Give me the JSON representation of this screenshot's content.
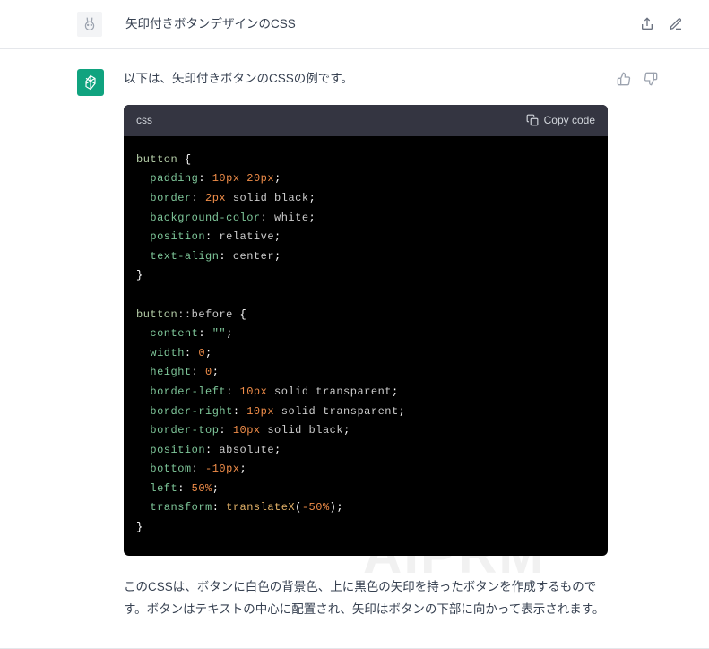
{
  "header": {
    "title": "矢印付きボタンデザインのCSS"
  },
  "watermark": "AIPRM",
  "response": {
    "intro": "以下は、矢印付きボタンのCSSの例です。",
    "body": "このCSSは、ボタンに白色の背景色、上に黒色の矢印を持ったボタンを作成するものです。ボタンはテキストの中心に配置され、矢印はボタンの下部に向かって表示されます。",
    "code": {
      "language": "css",
      "copy_label": "Copy code",
      "lines": [
        [
          {
            "t": "button ",
            "c": "tk-sel"
          },
          {
            "t": "{",
            "c": "tk-punc"
          }
        ],
        [
          {
            "t": "  ",
            "c": ""
          },
          {
            "t": "padding",
            "c": "tk-prop"
          },
          {
            "t": ": ",
            "c": "tk-punc"
          },
          {
            "t": "10px",
            "c": "tk-num"
          },
          {
            "t": " ",
            "c": ""
          },
          {
            "t": "20px",
            "c": "tk-num"
          },
          {
            "t": ";",
            "c": "tk-punc"
          }
        ],
        [
          {
            "t": "  ",
            "c": ""
          },
          {
            "t": "border",
            "c": "tk-prop"
          },
          {
            "t": ": ",
            "c": "tk-punc"
          },
          {
            "t": "2px",
            "c": "tk-num"
          },
          {
            "t": " solid black",
            "c": "tk-kw"
          },
          {
            "t": ";",
            "c": "tk-punc"
          }
        ],
        [
          {
            "t": "  ",
            "c": ""
          },
          {
            "t": "background-color",
            "c": "tk-prop"
          },
          {
            "t": ": ",
            "c": "tk-punc"
          },
          {
            "t": "white",
            "c": "tk-kw"
          },
          {
            "t": ";",
            "c": "tk-punc"
          }
        ],
        [
          {
            "t": "  ",
            "c": ""
          },
          {
            "t": "position",
            "c": "tk-prop"
          },
          {
            "t": ": ",
            "c": "tk-punc"
          },
          {
            "t": "relative",
            "c": "tk-kw"
          },
          {
            "t": ";",
            "c": "tk-punc"
          }
        ],
        [
          {
            "t": "  ",
            "c": ""
          },
          {
            "t": "text-align",
            "c": "tk-prop"
          },
          {
            "t": ": ",
            "c": "tk-punc"
          },
          {
            "t": "center",
            "c": "tk-kw"
          },
          {
            "t": ";",
            "c": "tk-punc"
          }
        ],
        [
          {
            "t": "}",
            "c": "tk-punc"
          }
        ],
        [
          {
            "t": " ",
            "c": ""
          }
        ],
        [
          {
            "t": "button",
            "c": "tk-sel"
          },
          {
            "t": "::before ",
            "c": "tk-pseudo"
          },
          {
            "t": "{",
            "c": "tk-punc"
          }
        ],
        [
          {
            "t": "  ",
            "c": ""
          },
          {
            "t": "content",
            "c": "tk-prop"
          },
          {
            "t": ": ",
            "c": "tk-punc"
          },
          {
            "t": "\"\"",
            "c": "tk-str"
          },
          {
            "t": ";",
            "c": "tk-punc"
          }
        ],
        [
          {
            "t": "  ",
            "c": ""
          },
          {
            "t": "width",
            "c": "tk-prop"
          },
          {
            "t": ": ",
            "c": "tk-punc"
          },
          {
            "t": "0",
            "c": "tk-num"
          },
          {
            "t": ";",
            "c": "tk-punc"
          }
        ],
        [
          {
            "t": "  ",
            "c": ""
          },
          {
            "t": "height",
            "c": "tk-prop"
          },
          {
            "t": ": ",
            "c": "tk-punc"
          },
          {
            "t": "0",
            "c": "tk-num"
          },
          {
            "t": ";",
            "c": "tk-punc"
          }
        ],
        [
          {
            "t": "  ",
            "c": ""
          },
          {
            "t": "border-left",
            "c": "tk-prop"
          },
          {
            "t": ": ",
            "c": "tk-punc"
          },
          {
            "t": "10px",
            "c": "tk-num"
          },
          {
            "t": " solid transparent",
            "c": "tk-kw"
          },
          {
            "t": ";",
            "c": "tk-punc"
          }
        ],
        [
          {
            "t": "  ",
            "c": ""
          },
          {
            "t": "border-right",
            "c": "tk-prop"
          },
          {
            "t": ": ",
            "c": "tk-punc"
          },
          {
            "t": "10px",
            "c": "tk-num"
          },
          {
            "t": " solid transparent",
            "c": "tk-kw"
          },
          {
            "t": ";",
            "c": "tk-punc"
          }
        ],
        [
          {
            "t": "  ",
            "c": ""
          },
          {
            "t": "border-top",
            "c": "tk-prop"
          },
          {
            "t": ": ",
            "c": "tk-punc"
          },
          {
            "t": "10px",
            "c": "tk-num"
          },
          {
            "t": " solid black",
            "c": "tk-kw"
          },
          {
            "t": ";",
            "c": "tk-punc"
          }
        ],
        [
          {
            "t": "  ",
            "c": ""
          },
          {
            "t": "position",
            "c": "tk-prop"
          },
          {
            "t": ": ",
            "c": "tk-punc"
          },
          {
            "t": "absolute",
            "c": "tk-kw"
          },
          {
            "t": ";",
            "c": "tk-punc"
          }
        ],
        [
          {
            "t": "  ",
            "c": ""
          },
          {
            "t": "bottom",
            "c": "tk-prop"
          },
          {
            "t": ": ",
            "c": "tk-punc"
          },
          {
            "t": "-10px",
            "c": "tk-num"
          },
          {
            "t": ";",
            "c": "tk-punc"
          }
        ],
        [
          {
            "t": "  ",
            "c": ""
          },
          {
            "t": "left",
            "c": "tk-prop"
          },
          {
            "t": ": ",
            "c": "tk-punc"
          },
          {
            "t": "50%",
            "c": "tk-num"
          },
          {
            "t": ";",
            "c": "tk-punc"
          }
        ],
        [
          {
            "t": "  ",
            "c": ""
          },
          {
            "t": "transform",
            "c": "tk-prop"
          },
          {
            "t": ": ",
            "c": "tk-punc"
          },
          {
            "t": "translateX",
            "c": "tk-func"
          },
          {
            "t": "(",
            "c": "tk-punc"
          },
          {
            "t": "-50%",
            "c": "tk-num"
          },
          {
            "t": ")",
            "c": "tk-punc"
          },
          {
            "t": ";",
            "c": "tk-punc"
          }
        ],
        [
          {
            "t": "}",
            "c": "tk-punc"
          }
        ]
      ]
    }
  }
}
